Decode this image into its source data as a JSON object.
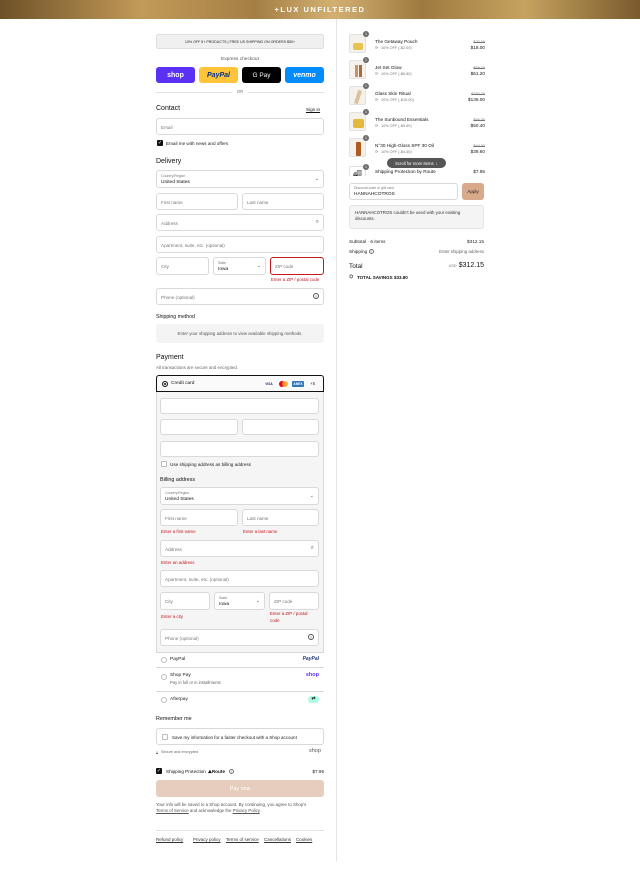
{
  "banner": {
    "title": "+LUX UNFILTERED"
  },
  "promo_bar": {
    "text": "10% OFF 5+ PRODUCTS | FREE US SHIPPING ON ORDERS $50+"
  },
  "express": {
    "title": "Express checkout",
    "or": "OR",
    "shop": "shop",
    "paypal": "PayPal",
    "gpay": "G Pay",
    "venmo": "venmo"
  },
  "contact": {
    "heading": "Contact",
    "sign_in": "Sign in",
    "email_placeholder": "Email",
    "news_label": "Email me with news and offers"
  },
  "delivery": {
    "heading": "Delivery",
    "country_label": "Country/Region",
    "country_value": "United States",
    "first_name": "First name",
    "last_name": "Last name",
    "address": "Address",
    "apartment": "Apartment, suite, etc. (optional)",
    "city": "City",
    "state_label": "State",
    "state_value": "Iowa",
    "zip": "ZIP code",
    "zip_error": "Enter a ZIP / postal code",
    "phone": "Phone (optional)"
  },
  "shipping_method": {
    "heading": "Shipping method",
    "message": "Enter your shipping address to view available shipping methods."
  },
  "payment": {
    "heading": "Payment",
    "subtitle": "All transactions are secure and encrypted.",
    "credit_card": "Credit card",
    "more_cards": "+5",
    "card_brands": [
      "VISA",
      "MC",
      "AMEX"
    ],
    "billing_same": "Use shipping address as billing address",
    "billing_heading": "Billing address",
    "country_label": "Country/Region",
    "country_value": "United States",
    "first_name": "First name",
    "last_name": "Last name",
    "first_error": "Enter a first name",
    "last_error": "Enter a last name",
    "address": "Address",
    "address_error": "Enter an address",
    "apartment": "Apartment, suite, etc. (optional)",
    "city": "City",
    "state_label": "State",
    "state_value": "Iowa",
    "zip": "ZIP code",
    "city_error": "Enter a city",
    "zip_error_1": "Enter a ZIP / postal",
    "zip_error_2": "code",
    "phone": "Phone (optional)",
    "paypal": "PayPal",
    "paypal_logo": "PayPal",
    "shoppay": "Shop Pay",
    "shoppay_sub": "Pay in full or in installments",
    "shoppay_logo": "shop",
    "afterpay": "Afterpay"
  },
  "remember": {
    "heading": "Remember me",
    "save_label": "Save my information for a faster checkout with a Shop account",
    "secure": "Secure and encrypted",
    "shop_logo": "shop"
  },
  "protection": {
    "label": "Shipping Protection",
    "route": "Route",
    "price": "$7.95"
  },
  "pay_button": "Pay now",
  "terms": {
    "line1": "Your info will be saved to a Shop account. By continuing, you agree to Shop's",
    "tos": "Terms of Service",
    "and": " and acknowledge the ",
    "privacy": "Privacy Policy",
    "end": "."
  },
  "footer_links": [
    "Refund policy",
    "Privacy policy",
    "Terms of service",
    "Cancellations",
    "Cookies"
  ],
  "cart": {
    "items": [
      {
        "qty": "1",
        "name": "The Getaway Pouch",
        "discount": "10% OFF (-$2.00)",
        "old": "$20.00",
        "price": "$18.00"
      },
      {
        "qty": "1",
        "name": "Jet Set Glow",
        "discount": "10% OFF (-$6.80)",
        "old": "$68.00",
        "price": "$61.20"
      },
      {
        "qty": "1",
        "name": "Glass Skin Ritual",
        "discount": "10% OFF (-$15.00)",
        "old": "$150.00",
        "price": "$135.00"
      },
      {
        "qty": "1",
        "name": "The Sunbound Essentials",
        "discount": "10% OFF (-$5.60)",
        "old": "$56.00",
        "price": "$50.40"
      },
      {
        "qty": "1",
        "name": "N°30 High-Gloss SPF 30 Oil",
        "discount": "10% OFF (-$4.40)",
        "old": "$44.00",
        "price": "$39.60"
      },
      {
        "qty": "1",
        "name": "Shipping Protection by Route",
        "discount": "",
        "old": "",
        "price": "$7.95"
      }
    ],
    "scroll_hint": "Scroll for more items",
    "discount_label": "Discount code or gift card",
    "discount_value": "HANNAHCOTROS",
    "apply": "Apply",
    "discount_error": "HANNAHCOTROS couldn't be used with your existing discounts.",
    "subtotal_label": "Subtotal · 6 items",
    "subtotal_value": "$312.15",
    "shipping_label": "Shipping",
    "shipping_value": "Enter shipping address",
    "total_label": "Total",
    "currency": "USD",
    "total_value": "$312.15",
    "savings_label": "TOTAL SAVINGS",
    "savings_value": "$33.80"
  }
}
